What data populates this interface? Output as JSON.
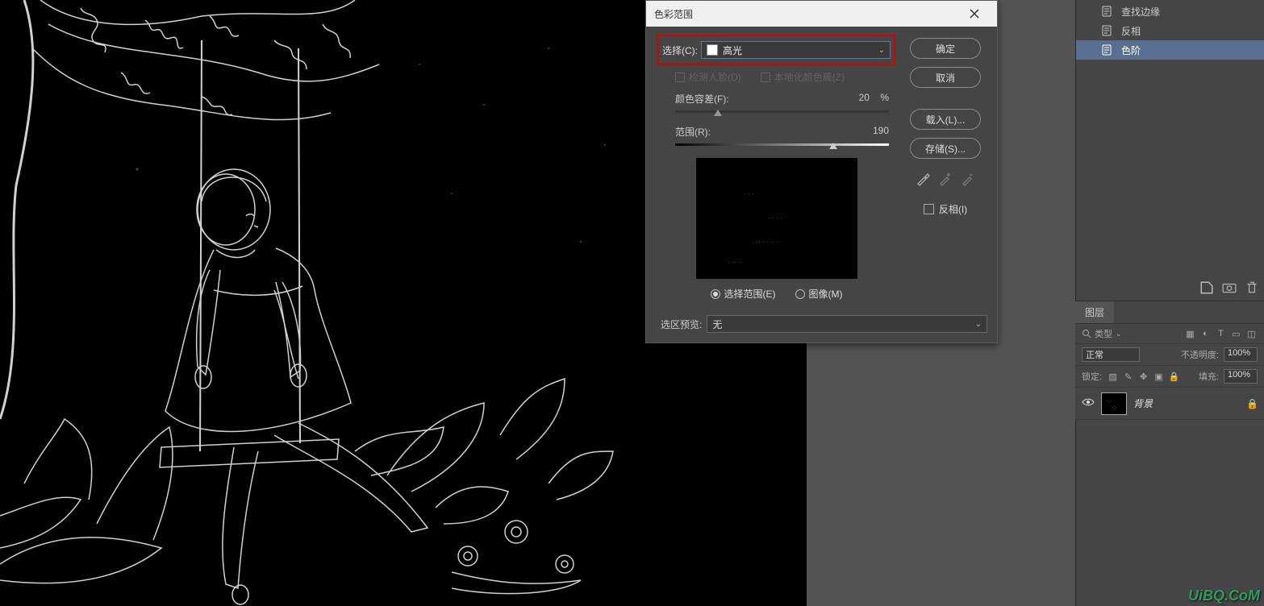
{
  "dialog": {
    "title": "色彩范围",
    "select_label": "选择(C):",
    "select_value": "高光",
    "detect_faces": "检测人脸(D)",
    "localized": "本地化颜色簇(Z)",
    "fuzziness_label": "颜色容差(F):",
    "fuzziness_value": "20",
    "fuzziness_unit": "%",
    "range_label": "范围(R):",
    "range_value": "190",
    "radio_selection": "选择范围(E)",
    "radio_image": "图像(M)",
    "preview_label": "选区预览:",
    "preview_value": "无",
    "buttons": {
      "ok": "确定",
      "cancel": "取消",
      "load": "载入(L)...",
      "save": "存储(S)..."
    },
    "invert": "反相(I)"
  },
  "history": {
    "items": [
      {
        "label": "查找边缘"
      },
      {
        "label": "反相"
      },
      {
        "label": "色阶"
      }
    ]
  },
  "layers": {
    "tab": "图层",
    "filter_label": "类型",
    "blend_mode": "正常",
    "opacity_label": "不透明度:",
    "opacity_value": "100%",
    "lock_label": "锁定:",
    "fill_label": "填充:",
    "fill_value": "100%",
    "bg_layer": "背景"
  },
  "watermark": "UiBQ.CoM"
}
